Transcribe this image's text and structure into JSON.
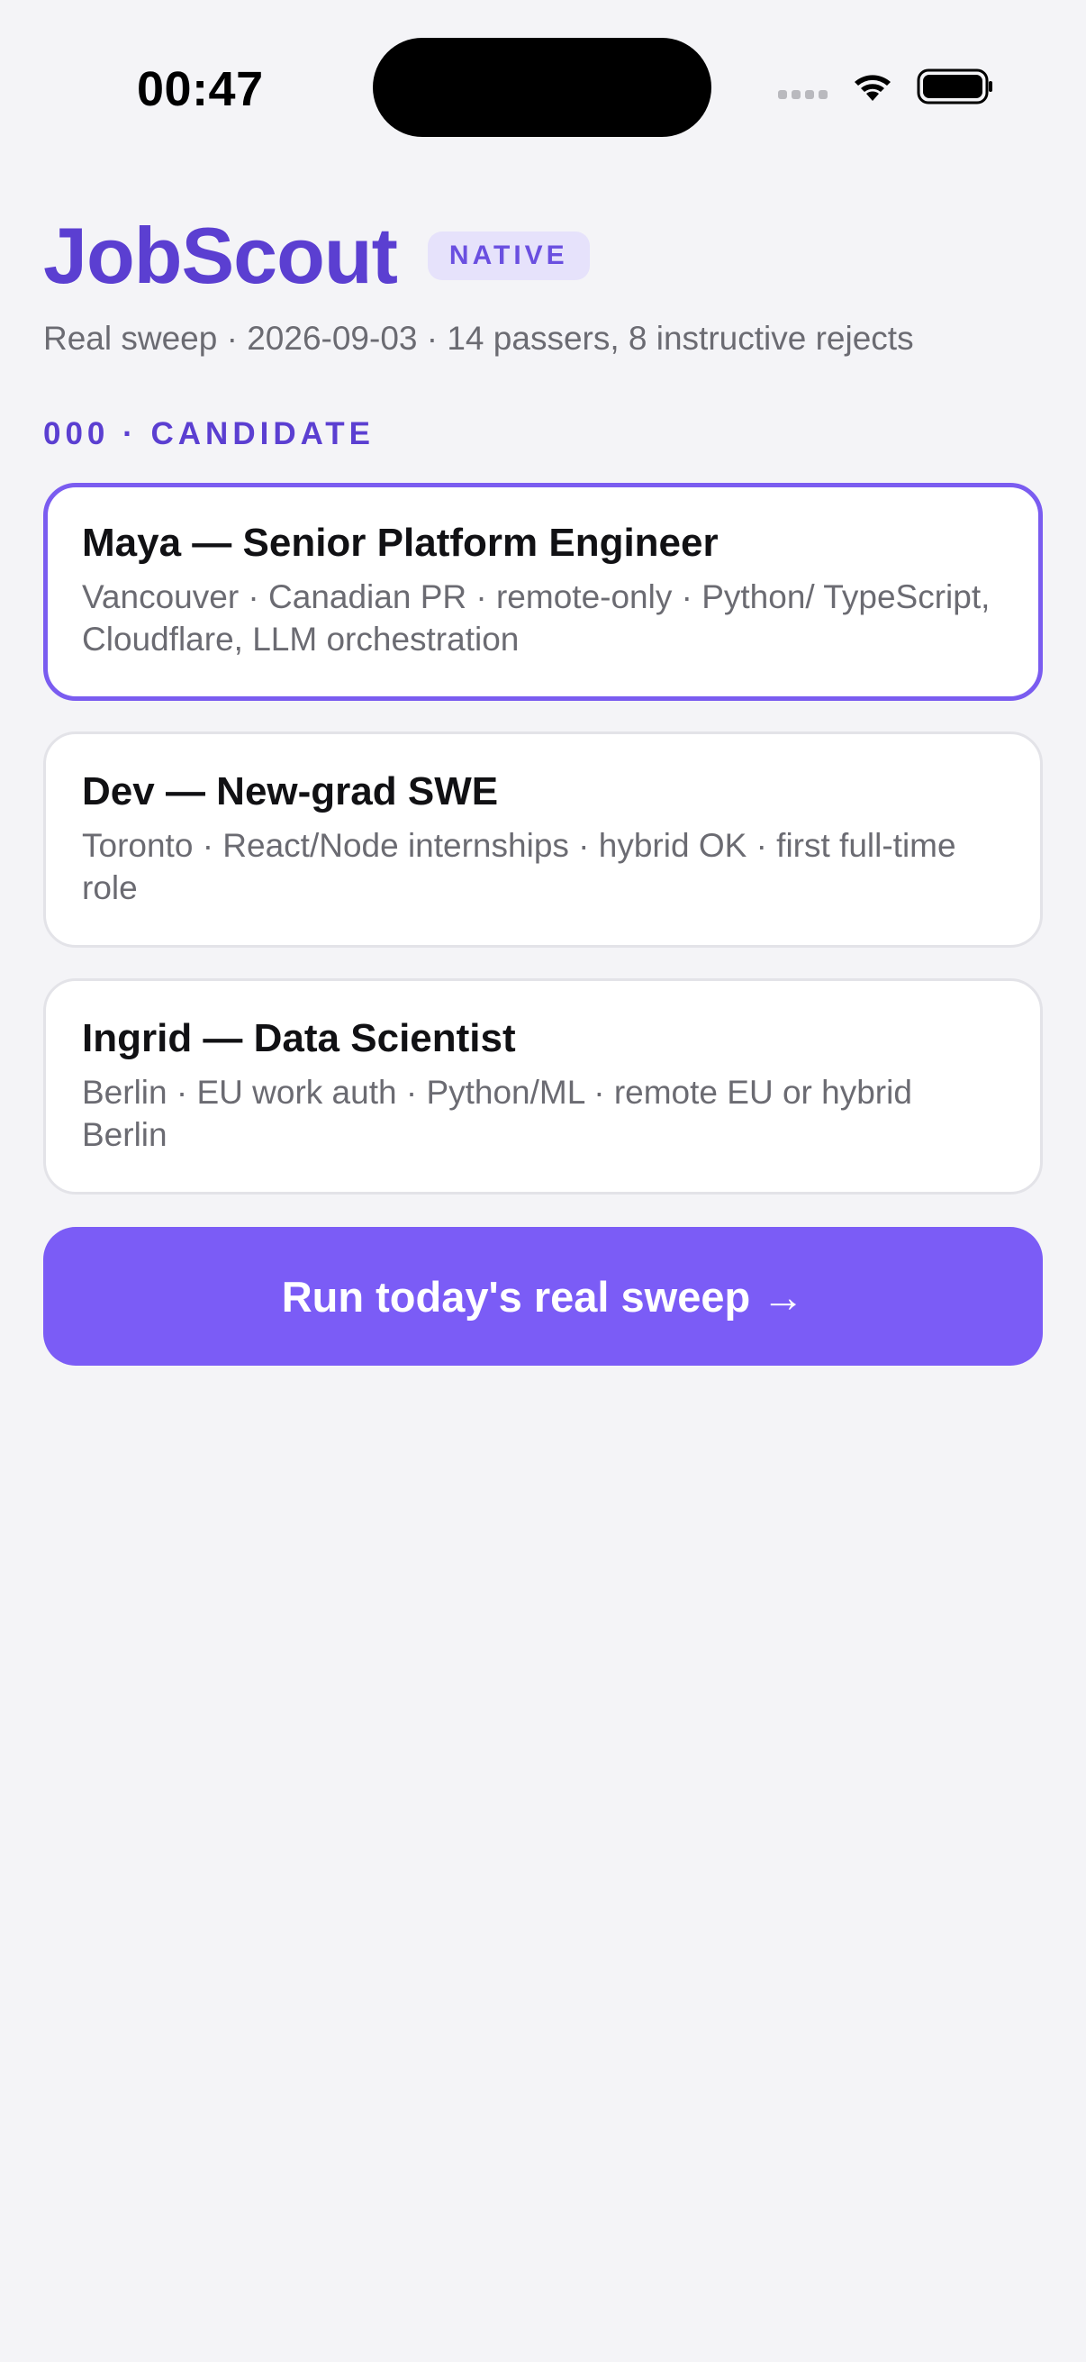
{
  "status_bar": {
    "time": "00:47",
    "icons": [
      "signal-icon",
      "wifi-icon",
      "battery-icon"
    ]
  },
  "header": {
    "title": "JobScout",
    "badge": "NATIVE",
    "subtitle": "Real sweep · 2026-09-03 · 14 passers, 8 instructive rejects"
  },
  "section": {
    "label": "000 · CANDIDATE"
  },
  "candidates": [
    {
      "title": "Maya — Senior Platform Engineer",
      "details": "Vancouver · Canadian PR · remote-only · Python/ TypeScript, Cloudflare, LLM orchestration",
      "selected": true
    },
    {
      "title": "Dev — New-grad SWE",
      "details": "Toronto · React/Node internships · hybrid OK · first full-time role",
      "selected": false
    },
    {
      "title": "Ingrid — Data Scientist",
      "details": "Berlin · EU work auth · Python/ML · remote EU or hybrid Berlin",
      "selected": false
    }
  ],
  "action": {
    "run_label": "Run today's real sweep →"
  },
  "colors": {
    "accent": "#5b3fd1",
    "button": "#7b5cf6",
    "selected_border": "#7a5cf0",
    "background": "#f4f4f7"
  }
}
